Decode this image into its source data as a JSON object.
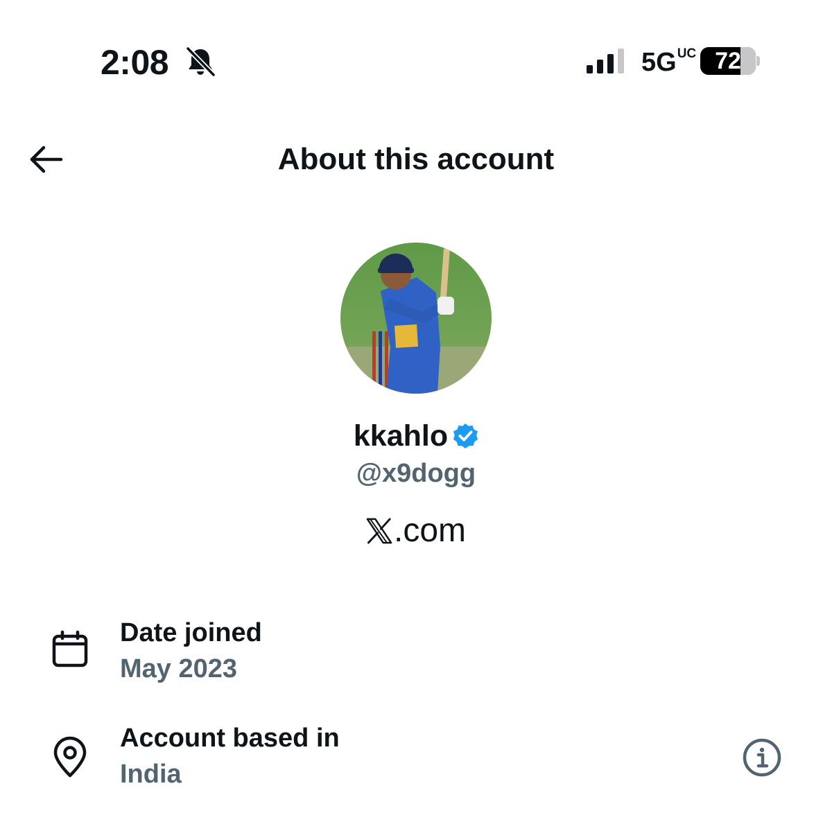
{
  "status_bar": {
    "time": "2:08",
    "network": "5G",
    "network_suffix": "UC",
    "battery_level": "72",
    "battery_fraction": 0.72,
    "icons": [
      "bell-slash-icon",
      "signal-bars-icon",
      "battery-icon"
    ]
  },
  "header": {
    "title": "About this account",
    "back_icon": "arrow-left-icon"
  },
  "profile": {
    "display_name": "kkahlo",
    "handle": "@x9dogg",
    "verified": true,
    "verified_color": "#1d9bf0",
    "avatar_icon": "avatar-photo",
    "platform_label": ".com",
    "platform_logo": "x-logo-icon"
  },
  "details": {
    "date_joined": {
      "label": "Date joined",
      "value": "May 2023",
      "icon": "calendar-icon"
    },
    "account_based": {
      "label": "Account based in",
      "value": "India",
      "icon": "location-pin-icon",
      "action_icon": "info-icon"
    }
  },
  "colors": {
    "primary_text": "#0f1419",
    "secondary_text": "#536471",
    "background": "#ffffff",
    "accent": "#1d9bf0"
  }
}
